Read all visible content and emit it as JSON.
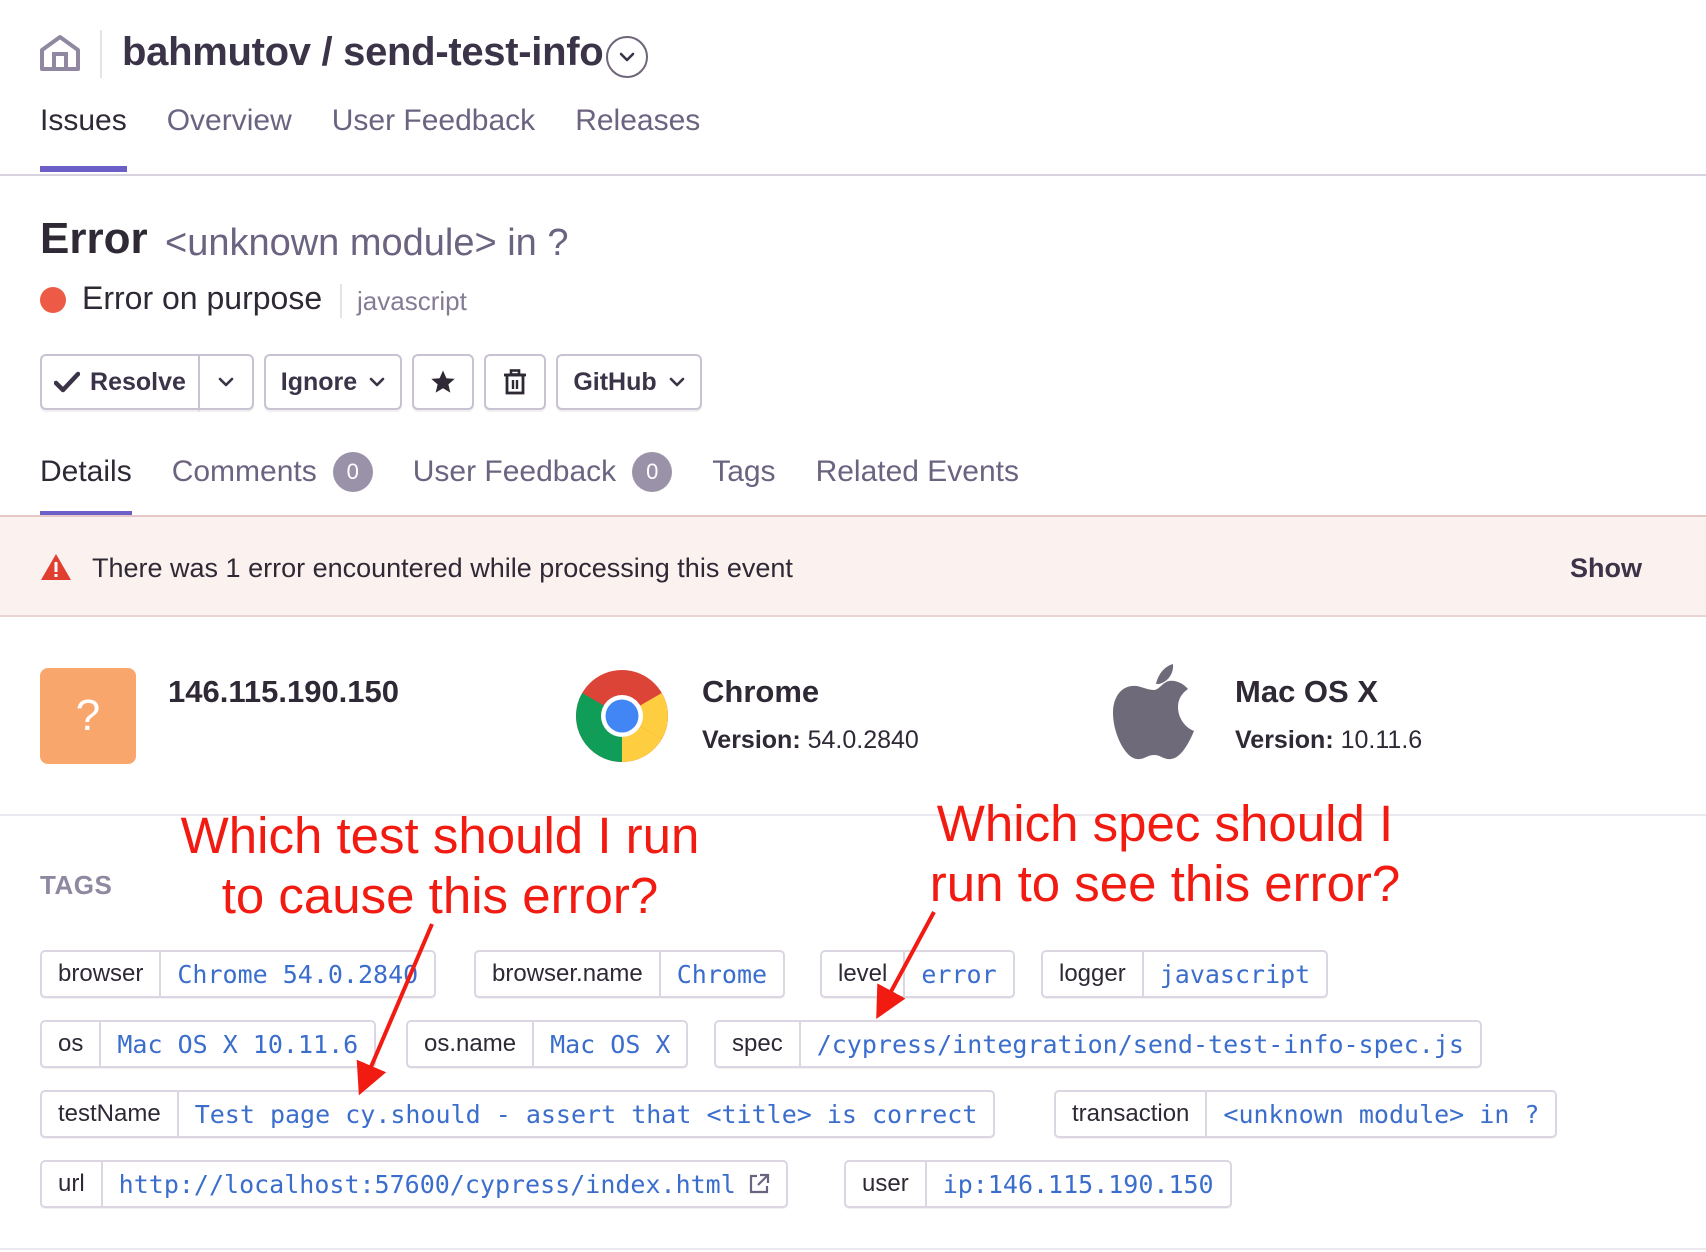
{
  "header": {
    "project_title": "bahmutov / send-test-info"
  },
  "nav": {
    "tabs": [
      {
        "label": "Issues",
        "active": true
      },
      {
        "label": "Overview"
      },
      {
        "label": "User Feedback"
      },
      {
        "label": "Releases"
      }
    ]
  },
  "issue": {
    "type": "Error",
    "culprit": "<unknown module> in ?",
    "message": "Error on purpose",
    "platform": "javascript",
    "level_color": "#ed5a45"
  },
  "actions": {
    "resolve": "Resolve",
    "ignore": "Ignore",
    "github": "GitHub",
    "bookmark_icon": "star-icon",
    "delete_icon": "trash-icon"
  },
  "subtabs": {
    "details": "Details",
    "comments": "Comments",
    "comments_count": "0",
    "user_feedback": "User Feedback",
    "user_feedback_count": "0",
    "tags": "Tags",
    "related_events": "Related Events"
  },
  "alert": {
    "text": "There was 1 error encountered while processing this event",
    "show": "Show"
  },
  "context": {
    "user": {
      "avatar": "?",
      "ip": "146.115.190.150"
    },
    "browser": {
      "name": "Chrome",
      "version_label": "Version:",
      "version": "54.0.2840"
    },
    "os": {
      "name": "Mac OS X",
      "version_label": "Version:",
      "version": "10.11.6"
    }
  },
  "tags": {
    "heading": "TAGS",
    "items": [
      {
        "key": "browser",
        "value": "Chrome 54.0.2840"
      },
      {
        "key": "browser.name",
        "value": "Chrome"
      },
      {
        "key": "level",
        "value": "error"
      },
      {
        "key": "logger",
        "value": "javascript"
      },
      {
        "key": "os",
        "value": "Mac OS X 10.11.6"
      },
      {
        "key": "os.name",
        "value": "Mac OS X"
      },
      {
        "key": "spec",
        "value": "/cypress/integration/send-test-info-spec.js"
      },
      {
        "key": "testName",
        "value": "Test page cy.should - assert that <title> is correct"
      },
      {
        "key": "transaction",
        "value": "<unknown module> in ?"
      },
      {
        "key": "url",
        "value": "http://localhost:57600/cypress/index.html"
      },
      {
        "key": "user",
        "value": "ip:146.115.190.150"
      }
    ]
  },
  "annotations": {
    "left_line1": "Which test should I run",
    "left_line2": "to cause this error?",
    "right_line1": "Which spec should I",
    "right_line2": "run to see this error?",
    "color": "#f21b12"
  },
  "colors": {
    "accent": "#6c5fc7",
    "link": "#3b6ecc",
    "alert_bg": "#fbf1ef"
  }
}
